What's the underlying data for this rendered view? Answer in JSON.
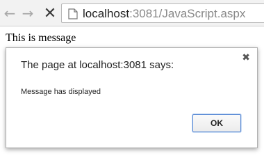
{
  "browser": {
    "icons": {
      "back": "arrow-left-icon",
      "forward": "arrow-right-icon",
      "reload": "close-icon",
      "page": "page-icon"
    },
    "url_host": "localhost",
    "url_path": ":3081/JavaScript.aspx"
  },
  "page": {
    "text": "This is message"
  },
  "dialog": {
    "title": "The page at localhost:3081 says:",
    "message": "Message has displayed",
    "ok_label": "OK",
    "close_icon": "close-icon"
  }
}
